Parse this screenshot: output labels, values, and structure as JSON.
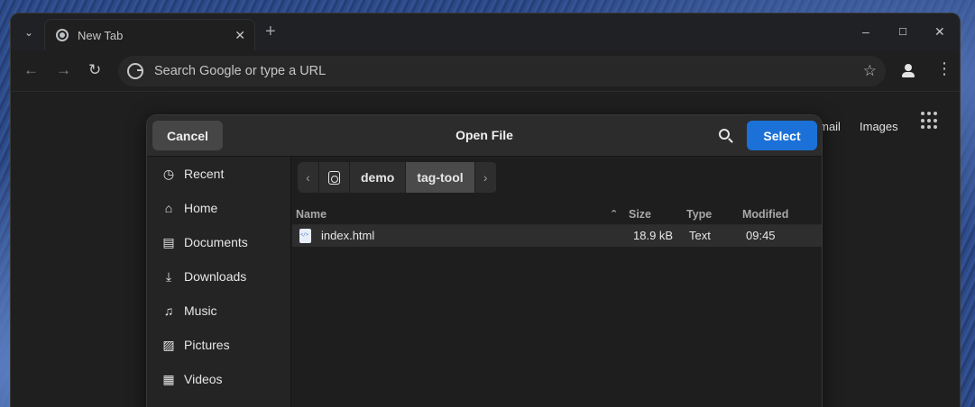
{
  "browser": {
    "tab": {
      "title": "New Tab"
    },
    "window_controls": {
      "minimize": "–",
      "maximize": "☐",
      "close": "✕"
    },
    "omnibox": {
      "placeholder": "Search Google or type a URL"
    },
    "ntp": {
      "gmail": "Gmail",
      "images": "Images"
    }
  },
  "dialog": {
    "title": "Open File",
    "cancel_label": "Cancel",
    "select_label": "Select",
    "sidebar": [
      {
        "label": "Recent",
        "icon": "clock-icon"
      },
      {
        "label": "Home",
        "icon": "home-icon"
      },
      {
        "label": "Documents",
        "icon": "document-icon"
      },
      {
        "label": "Downloads",
        "icon": "download-icon"
      },
      {
        "label": "Music",
        "icon": "music-icon"
      },
      {
        "label": "Pictures",
        "icon": "picture-icon"
      },
      {
        "label": "Videos",
        "icon": "video-icon"
      }
    ],
    "pathbar": {
      "segments": [
        "demo",
        "tag-tool"
      ],
      "current": "tag-tool"
    },
    "columns": {
      "name": "Name",
      "size": "Size",
      "type": "Type",
      "modified": "Modified"
    },
    "files": [
      {
        "name": "index.html",
        "size": "18.9 kB",
        "type": "Text",
        "modified": "09:45"
      }
    ]
  }
}
